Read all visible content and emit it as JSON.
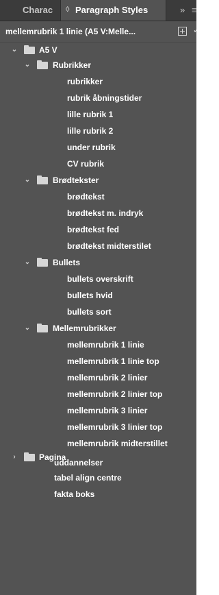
{
  "tabs": {
    "inactive_label": "Charac",
    "active_label": "Paragraph Styles",
    "active_icon": "diamond-icon",
    "overflow_label": "»",
    "menu_label": "≡"
  },
  "style_bar": {
    "current_style": "mellemrubrik 1 linie (A5 V:Melle..."
  },
  "tree": {
    "root": "A5 V",
    "groups": {
      "rubrikker": {
        "label": "Rubrikker",
        "items": [
          "rubrikker",
          "rubrik åbningstider",
          "lille rubrik 1",
          "lille rubrik 2",
          "under rubrik",
          "CV rubrik"
        ]
      },
      "brodtekster": {
        "label": "Brødtekster",
        "items": [
          "brødtekst",
          "brødtekst m. indryk",
          "brødtekst fed",
          "brødtekst midterstilet"
        ]
      },
      "bullets": {
        "label": "Bullets",
        "items": [
          "bullets overskrift",
          "bullets hvid",
          "bullets sort"
        ]
      },
      "mellemrubrikker": {
        "label": "Mellemrubrikker",
        "items": [
          "mellemrubrik 1 linie",
          "mellemrubrik 1 linie top",
          "mellemrubrik 2 linier",
          "mellemrubrik 2 linier top",
          "mellemrubrik 3 linier",
          "mellemrubrik 3 linier top",
          "mellemrubrik midterstillet"
        ]
      },
      "pagina": {
        "label": "Pagina"
      }
    },
    "trailing_items": [
      "uddannelser",
      "tabel align centre",
      "fakta boks"
    ]
  },
  "colors": {
    "panel_bg": "#535353",
    "tab_bar_bg": "#3b3b3b",
    "text": "#ffffff"
  }
}
